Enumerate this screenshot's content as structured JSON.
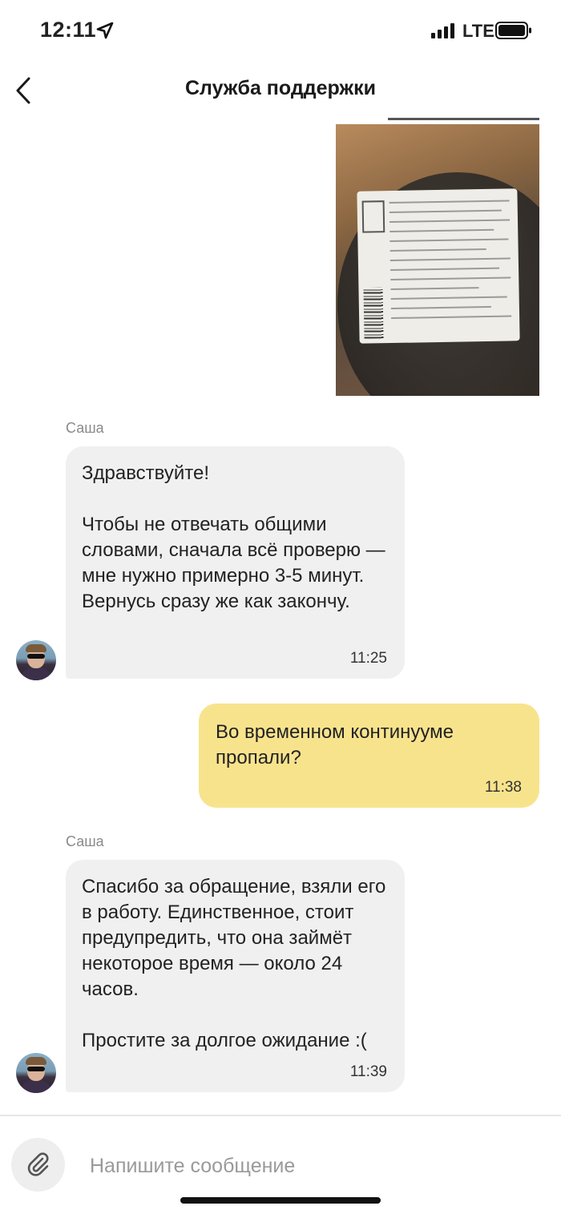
{
  "status_bar": {
    "time": "12:11",
    "network": "LTE",
    "icons": [
      "location-arrow-icon",
      "cellular-signal-icon",
      "battery-icon"
    ]
  },
  "header": {
    "title": "Служба поддержки",
    "back_icon": "chevron-left-icon"
  },
  "messages": [
    {
      "type": "image",
      "direction": "outgoing"
    },
    {
      "type": "text",
      "direction": "incoming",
      "sender": "Саша",
      "text": "Здравствуйте!\n\nЧтобы не отвечать общими словами, сначала всё проверю — мне нужно примерно 3-5 минут. Вернусь сразу же как закончу.",
      "time": "11:25"
    },
    {
      "type": "text",
      "direction": "outgoing",
      "text": "Во временном континууме пропали?",
      "time": "11:38"
    },
    {
      "type": "text",
      "direction": "incoming",
      "sender": "Саша",
      "text": "Спасибо за обращение, взяли его в работу. Единственное, стоит предупредить, что она займёт некоторое время — около 24 часов.\n\nПростите за долгое ожидание :(",
      "time": "11:39"
    }
  ],
  "composer": {
    "placeholder": "Напишите сообщение",
    "value": "",
    "attach_icon": "paperclip-icon"
  },
  "colors": {
    "incoming_bubble": "#f0f0f0",
    "outgoing_bubble": "#f8e38d",
    "meta_text": "#8a8a8a"
  }
}
